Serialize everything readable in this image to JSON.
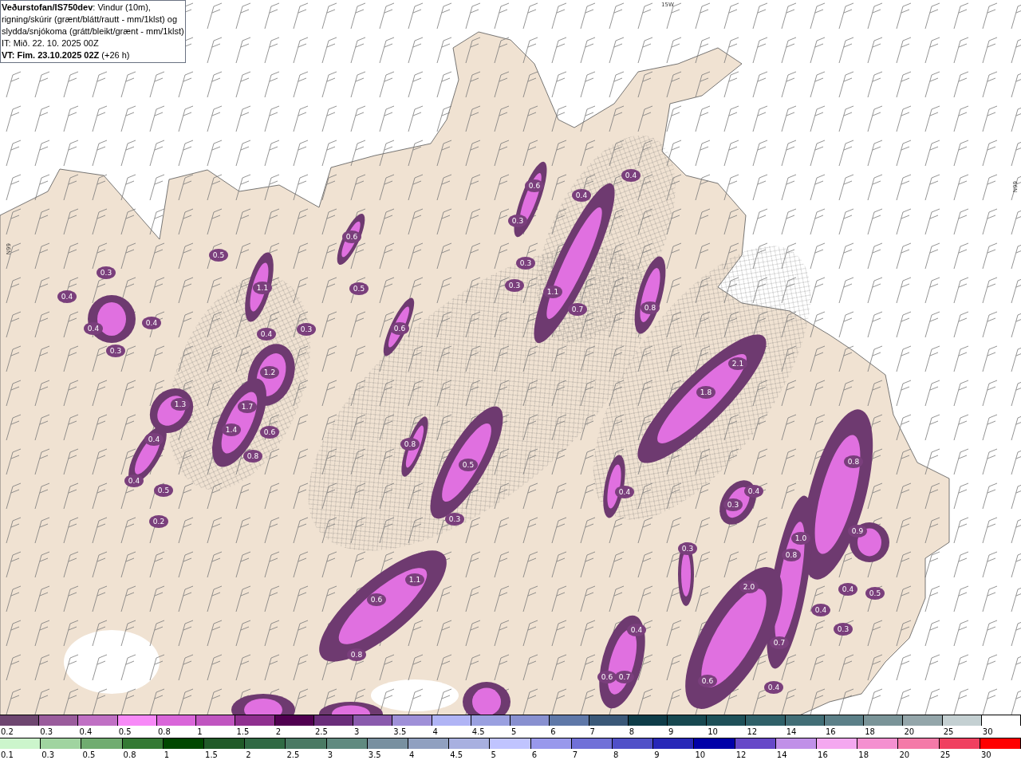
{
  "header": {
    "lines": [
      "**Veðurstofan/IS750dev**: Vindur (10m),",
      "rigning/skúrir (grænt/blátt/rautt - mm/1klst) og",
      "slydda/snjókoma (grátt/bleikt/grænt - mm/1klst)",
      "IT: Mið. 22. 10. 2025 00Z",
      "**VT: Fim. 23.10.2025 02Z** (+26 h)"
    ]
  },
  "map": {
    "grid_labels": [
      "15W",
      "66N",
      "66N"
    ],
    "values": [
      "0.5",
      "0.3",
      "0.4",
      "1.1",
      "0.6",
      "0.5",
      "0.4",
      "0.4",
      "0.4",
      "0.3",
      "0.6",
      "0.3",
      "1.2",
      "1.3",
      "1.7",
      "1.4",
      "0.6",
      "0.4",
      "0.8",
      "0.4",
      "0.5",
      "0.2",
      "0.6",
      "0.4",
      "0.4",
      "0.3",
      "0.3",
      "0.3",
      "1.1",
      "0.7",
      "0.8",
      "2.1",
      "1.8",
      "0.8",
      "0.5",
      "0.3",
      "0.4",
      "0.4",
      "0.3",
      "0.8",
      "0.9",
      "0.3",
      "1.0",
      "0.8",
      "1.1",
      "0.6",
      "2.0",
      "0.4",
      "0.5",
      "0.4",
      "0.3",
      "0.8",
      "0.7",
      "0.6",
      "0.7",
      "0.6",
      "0.4",
      "0.4"
    ]
  },
  "legend_snow": [
    {
      "label": "0.2",
      "color": "#6e4670"
    },
    {
      "label": "0.3",
      "color": "#9a5c9c"
    },
    {
      "label": "0.4",
      "color": "#c070c4"
    },
    {
      "label": "0.5",
      "color": "#f78af7"
    },
    {
      "label": "0.8",
      "color": "#d966d9"
    },
    {
      "label": "1",
      "color": "#c055c0"
    },
    {
      "label": "1.5",
      "color": "#8f2f8f"
    },
    {
      "label": "2",
      "color": "#500050"
    },
    {
      "label": "2.5",
      "color": "#6a2d7a"
    },
    {
      "label": "3",
      "color": "#8a5aad"
    },
    {
      "label": "3.5",
      "color": "#9f90d8"
    },
    {
      "label": "4",
      "color": "#b0b4f5"
    },
    {
      "label": "4.5",
      "color": "#9aa0e0"
    },
    {
      "label": "5",
      "color": "#8890d0"
    },
    {
      "label": "6",
      "color": "#5f78a8"
    },
    {
      "label": "7",
      "color": "#3a5878"
    },
    {
      "label": "8",
      "color": "#0e3c48"
    },
    {
      "label": "9",
      "color": "#174850"
    },
    {
      "label": "10",
      "color": "#1e5058"
    },
    {
      "label": "12",
      "color": "#2f6068"
    },
    {
      "label": "14",
      "color": "#426e76"
    },
    {
      "label": "16",
      "color": "#5c8088"
    },
    {
      "label": "18",
      "color": "#7a9498"
    },
    {
      "label": "20",
      "color": "#94a6aa"
    },
    {
      "label": "25",
      "color": "#c4d0d2"
    },
    {
      "label": "30",
      "color": "#ffffff"
    }
  ],
  "legend_rain": [
    {
      "label": "0.1",
      "color": "#ccf5cc"
    },
    {
      "label": "0.3",
      "color": "#a0d4a0"
    },
    {
      "label": "0.5",
      "color": "#70ac70"
    },
    {
      "label": "0.8",
      "color": "#347a34"
    },
    {
      "label": "1",
      "color": "#004800"
    },
    {
      "label": "1.5",
      "color": "#205a28"
    },
    {
      "label": "2",
      "color": "#306a44"
    },
    {
      "label": "2.5",
      "color": "#4a7a64"
    },
    {
      "label": "3",
      "color": "#608a80"
    },
    {
      "label": "3.5",
      "color": "#7890a0"
    },
    {
      "label": "4",
      "color": "#90a0c0"
    },
    {
      "label": "4.5",
      "color": "#a8b0e0"
    },
    {
      "label": "5",
      "color": "#c0c4ff"
    },
    {
      "label": "6",
      "color": "#9898ec"
    },
    {
      "label": "7",
      "color": "#7070d8"
    },
    {
      "label": "8",
      "color": "#5050c8"
    },
    {
      "label": "9",
      "color": "#2828b8"
    },
    {
      "label": "10",
      "color": "#0000a8"
    },
    {
      "label": "12",
      "color": "#6648c8"
    },
    {
      "label": "14",
      "color": "#c090e8"
    },
    {
      "label": "16",
      "color": "#f4a8f0"
    },
    {
      "label": "18",
      "color": "#f490d0"
    },
    {
      "label": "20",
      "color": "#f47aa8"
    },
    {
      "label": "25",
      "color": "#f04060"
    },
    {
      "label": "30",
      "color": "#ff0000"
    }
  ]
}
